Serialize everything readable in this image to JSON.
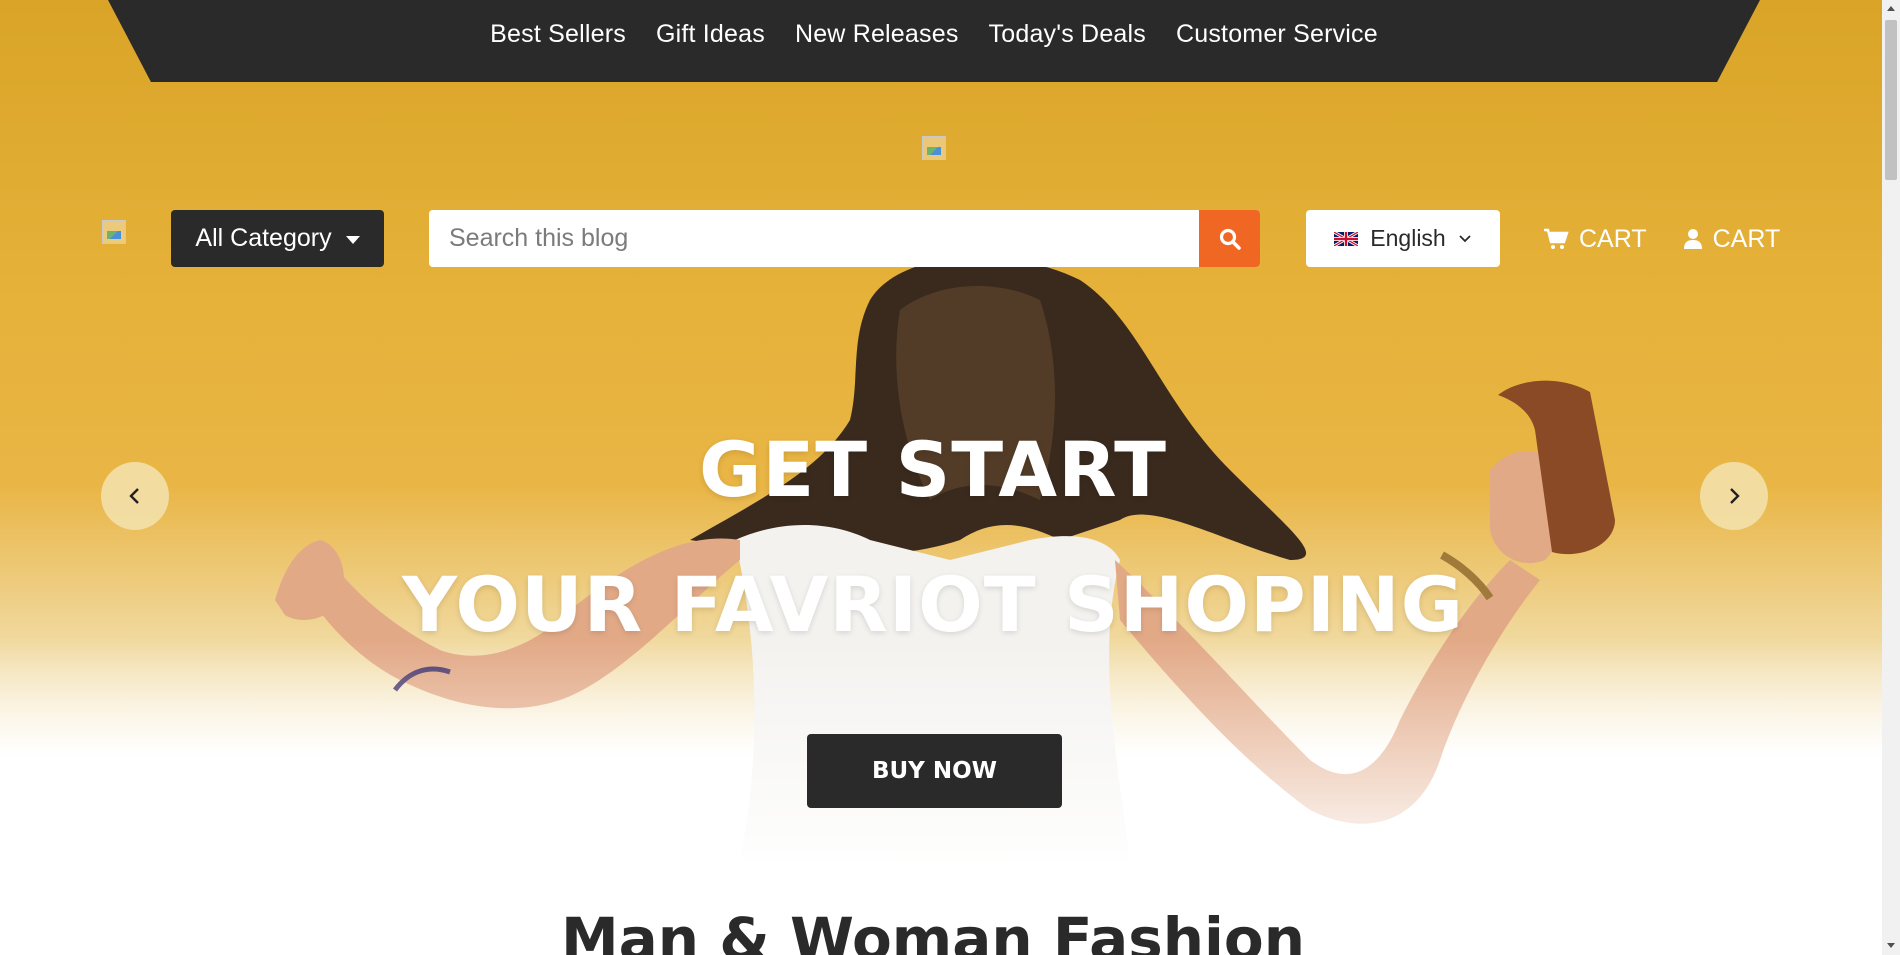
{
  "nav": {
    "items": [
      {
        "label": "Best Sellers"
      },
      {
        "label": "Gift Ideas"
      },
      {
        "label": "New Releases"
      },
      {
        "label": "Today's Deals"
      },
      {
        "label": "Customer Service"
      }
    ]
  },
  "header": {
    "category_label": "All Category",
    "search_placeholder": "Search this blog",
    "language_label": "English",
    "cart_label": "CART",
    "account_label": "CART"
  },
  "hero": {
    "title_line1": "GET START",
    "title_line2": "YOUR FAVRIOT SHOPING",
    "cta_label": "BUY NOW"
  },
  "section": {
    "title": "Man & Woman Fashion"
  },
  "colors": {
    "dark": "#2b2a2a",
    "accent": "#f06623",
    "hero_yellow": "#e6b23a"
  },
  "icons": [
    "search-icon",
    "uk-flag-icon",
    "chevron-down-icon",
    "cart-icon",
    "user-icon",
    "chevron-left-icon",
    "chevron-right-icon"
  ]
}
